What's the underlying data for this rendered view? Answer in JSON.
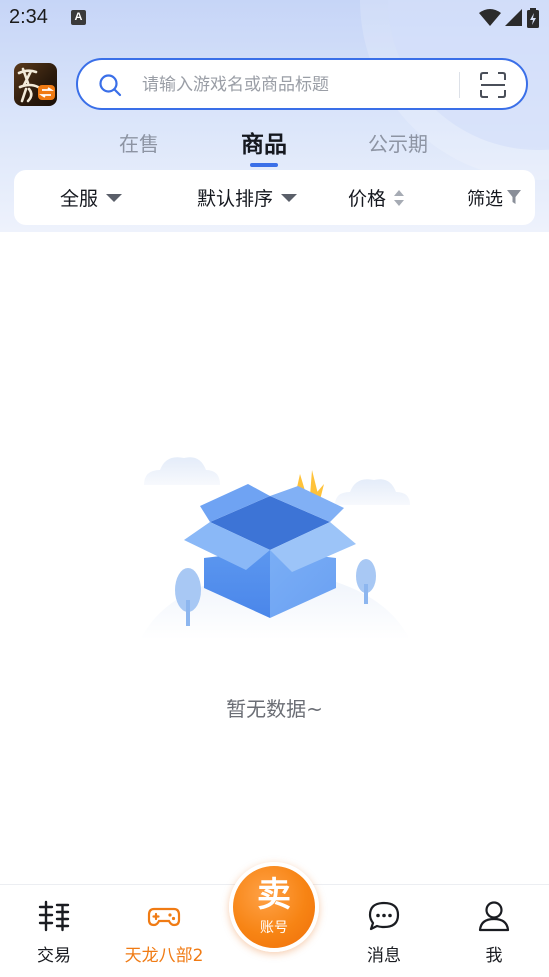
{
  "status_bar": {
    "time": "2:34",
    "notif_badge": "A"
  },
  "header": {
    "game_logo_alt": "天龙"
  },
  "search": {
    "placeholder": "请输入游戏名或商品标题"
  },
  "tabs": [
    {
      "label": "在售",
      "active": false
    },
    {
      "label": "商品",
      "active": true
    },
    {
      "label": "公示期",
      "active": false
    }
  ],
  "filters": {
    "server": "全服",
    "sort": "默认排序",
    "price": "价格",
    "filter": "筛选"
  },
  "empty_state": {
    "text": "暂无数据~"
  },
  "bottom_nav": {
    "items": [
      {
        "label": "交易",
        "icon": "trade-icon",
        "active": false
      },
      {
        "label": "天龙八部2",
        "icon": "gamepad-icon",
        "active": true
      },
      {
        "label": "消息",
        "icon": "message-icon",
        "active": false
      },
      {
        "label": "我",
        "icon": "user-icon",
        "active": false
      }
    ],
    "sell": {
      "main": "卖",
      "sub": "账号"
    }
  },
  "colors": {
    "accent": "#3a6fe8",
    "active_nav": "#f07b14",
    "sell_button": "#f78414",
    "header_bg": "#c6d5f7"
  }
}
